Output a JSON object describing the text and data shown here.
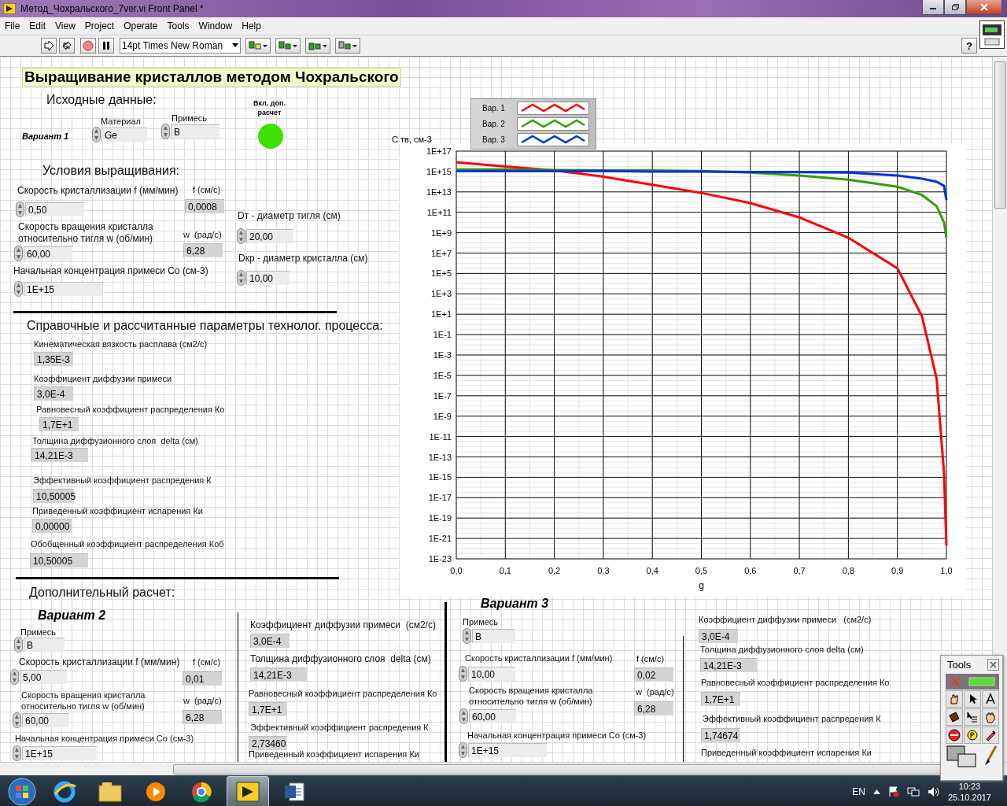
{
  "window": {
    "title": "Метод_Чохральского_7ver.vi Front Panel *"
  },
  "menu": [
    "File",
    "Edit",
    "View",
    "Project",
    "Operate",
    "Tools",
    "Window",
    "Help"
  ],
  "toolbar": {
    "font": "14pt Times New Roman",
    "help": "?"
  },
  "panel": {
    "title": "Выращивание кристаллов методом Чохральского",
    "headings": [
      "Исходные данные:",
      "Условия выращивания:",
      "Справочные и рассчитанные параметры технолог. процесса:",
      "Дополнительный расчет:"
    ],
    "variants": [
      "Вариант 1",
      "Вариант 2",
      "Вариант 3"
    ],
    "led": {
      "label": "Вкл. доп.\nрасчет",
      "on": true
    },
    "controls": [
      {
        "kind": "ring",
        "label": "Материал",
        "value": "Ge"
      },
      {
        "kind": "ring",
        "label": "Примесь",
        "value": "B"
      },
      {
        "kind": "numeric",
        "label": "Скорость кристаллизации f (мм/мин)",
        "value": "0,50"
      },
      {
        "kind": "indicator",
        "label": "f (см/с)",
        "value": "0,0008"
      },
      {
        "kind": "numeric",
        "label": "Скорость вращения кристалла\nотносительно тигля w (об/мин)",
        "value": "60,00"
      },
      {
        "kind": "indicator",
        "label": "w  (рад/с)",
        "value": "6,28"
      },
      {
        "kind": "numeric",
        "label": "Начальная концентрация примеси Со (см-3)",
        "value": "1E+15"
      },
      {
        "kind": "numeric",
        "label": "Dт - диаметр тигля (см)",
        "value": "20,00"
      },
      {
        "kind": "numeric",
        "label": "Dкр - диаметр кристалла (см)",
        "value": "10,00"
      },
      {
        "kind": "indicator",
        "label": "Кинематическая вязкость расплава (см2/с)",
        "value": "1,35E-3"
      },
      {
        "kind": "indicator",
        "label": "Коэффициент диффузии примеси",
        "value": "3,0E-4"
      },
      {
        "kind": "indicator",
        "label": "Равновесный коэффициент распределения Ко",
        "value": "1,7E+1"
      },
      {
        "kind": "indicator",
        "label": "Толщина диффузионного слоя  delta (см)",
        "value": "14,21E-3"
      },
      {
        "kind": "indicator",
        "label": "Эффективный коэффициент распредения К",
        "value": "10,50005"
      },
      {
        "kind": "indicator",
        "label": "Приведенный коэффициент испарения Ки",
        "value": "0,00000"
      },
      {
        "kind": "indicator",
        "label": "Обобщенный коэффициент распределения Коб",
        "value": "10,50005"
      },
      {
        "kind": "ring",
        "label": "Примесь",
        "value": "B"
      },
      {
        "kind": "numeric",
        "label": "Скорость кристаллизации f (мм/мин)",
        "value": "5,00"
      },
      {
        "kind": "indicator",
        "label": "f (см/с)",
        "value": "0,01"
      },
      {
        "kind": "numeric",
        "label": "Скорость вращения кристалла\nотносительно тигля w (об/мин)",
        "value": "60,00"
      },
      {
        "kind": "indicator",
        "label": "w  (рад/с)",
        "value": "6,28"
      },
      {
        "kind": "numeric",
        "label": "Начальная концентрация примеси Со (см-3)",
        "value": "1E+15"
      },
      {
        "kind": "indicator",
        "label": "Коэффициент диффузии примеси  (см2/с)",
        "value": "3,0E-4"
      },
      {
        "kind": "indicator",
        "label": "Толщина диффузионного слоя  delta (см)",
        "value": "14,21E-3"
      },
      {
        "kind": "indicator",
        "label": "Равновесный коэффициент распределения Ко",
        "value": "1,7E+1"
      },
      {
        "kind": "indicator",
        "label": "Эффективный коэффициент распредения К",
        "value": "2,73460"
      },
      {
        "kind": "indicator",
        "label": "Приведенный коэффициент испарения Ки"
      },
      {
        "kind": "ring",
        "label": "Примесь",
        "value": "B"
      },
      {
        "kind": "numeric",
        "label": "Скорость кристаллизации f (мм/мин)",
        "value": "10,00"
      },
      {
        "kind": "indicator",
        "label": "f (см/с)",
        "value": "0,02"
      },
      {
        "kind": "numeric",
        "label": "Скорость вращения кристалла\nотносительно тигля w (об/мин)",
        "value": "60,00"
      },
      {
        "kind": "indicator",
        "label": "w  (рад/с)",
        "value": "6,28"
      },
      {
        "kind": "numeric",
        "label": "Начальная концентрация примеси Со (см-3)",
        "value": "1E+15"
      },
      {
        "kind": "indicator",
        "label": "Коэффициент диффузии примеси   (см2/с)",
        "value": "3,0E-4"
      },
      {
        "kind": "indicator",
        "label": "Толщина диффузионного слоя delta (см)",
        "value": "14,21E-3"
      },
      {
        "kind": "indicator",
        "label": "Равновесный коэффициент распределения Ко",
        "value": "1,7E+1"
      },
      {
        "kind": "indicator",
        "label": "Эффективный коэффициент распредения К",
        "value": "1,74674"
      },
      {
        "kind": "indicator",
        "label": "Приведенный коэффициент испарения Ки"
      }
    ]
  },
  "chart": {
    "ylabel": "С тв, см-3",
    "xlabel": "g",
    "legend": [
      {
        "name": "Вар. 1",
        "color": "#ff0000"
      },
      {
        "name": "Вар. 2",
        "color": "#33a000"
      },
      {
        "name": "Вар. 3",
        "color": "#0033dd"
      }
    ],
    "x_tick_labels": [
      "0,0",
      "0,1",
      "0,2",
      "0,3",
      "0,4",
      "0,5",
      "0,6",
      "0,7",
      "0,8",
      "0,9",
      "1,0"
    ],
    "y_tick_labels": [
      "1E+17",
      "1E+15",
      "1E+13",
      "1E+11",
      "1E+9",
      "1E+7",
      "1E+5",
      "1E+3",
      "1E+1",
      "1E-1",
      "1E-3",
      "1E-5",
      "1E-7",
      "1E-9",
      "1E-11",
      "1E-13",
      "1E-15",
      "1E-17",
      "1E-19",
      "1E-21",
      "1E-23"
    ]
  },
  "tools_palette": {
    "title": "Tools"
  },
  "taskbar": {
    "language": "EN",
    "time": "10:23",
    "date": "25.10.2017"
  }
}
